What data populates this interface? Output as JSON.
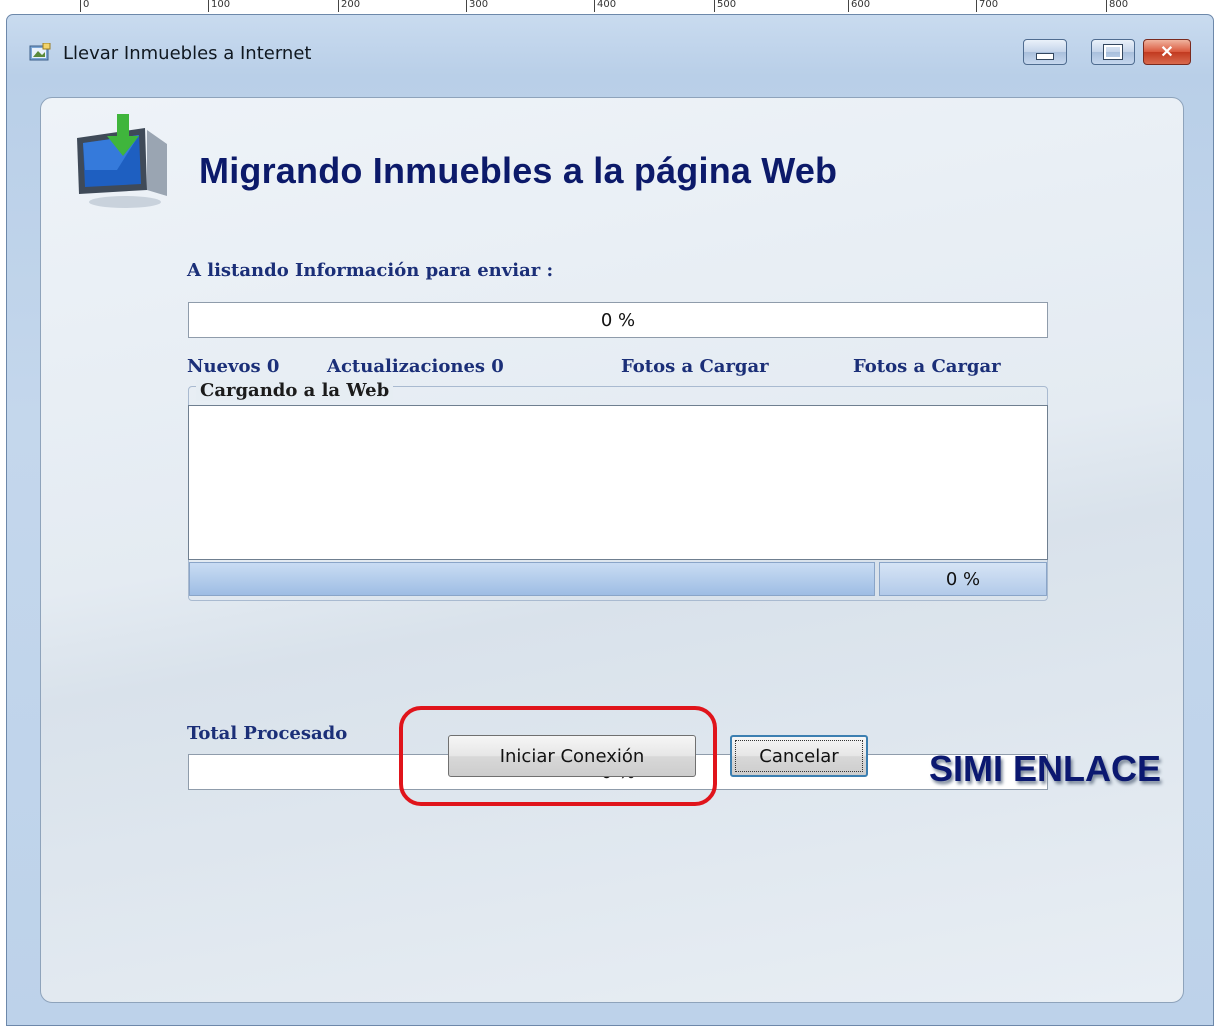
{
  "ruler": {
    "ticks": [
      "0",
      "100",
      "200",
      "300",
      "400",
      "500",
      "600",
      "700",
      "800"
    ]
  },
  "window": {
    "title": "Llevar Inmuebles a Internet",
    "controls": {
      "minimize_icon": "minimize-icon",
      "maximize_icon": "maximize-icon",
      "close_icon": "close-icon",
      "close_glyph": "✕"
    }
  },
  "header": {
    "logo_icon": "monitor-download-icon",
    "title": "Migrando Inmuebles a la página Web"
  },
  "listing": {
    "label": "A listando Información para enviar :",
    "progress_text": "0 %",
    "progress_value": 0
  },
  "counters": {
    "nuevos": "Nuevos  0",
    "actualizaciones": "Actualizaciones 0",
    "fotos_1": "Fotos a Cargar",
    "fotos_2": "Fotos a Cargar"
  },
  "upload": {
    "group_title": "Cargando a la Web",
    "progress_text": "0 %",
    "progress_value": 0
  },
  "total": {
    "label": "Total Procesado",
    "progress_text": "0 %",
    "progress_value": 0
  },
  "buttons": {
    "start_label": "Iniciar Conexión",
    "cancel_label": "Cancelar"
  },
  "brand": "SIMI ENLACE",
  "colors": {
    "heading": "#0c1a6a",
    "label": "#1b2f78",
    "highlight": "#e0141b",
    "close_button": "#d9573c"
  }
}
